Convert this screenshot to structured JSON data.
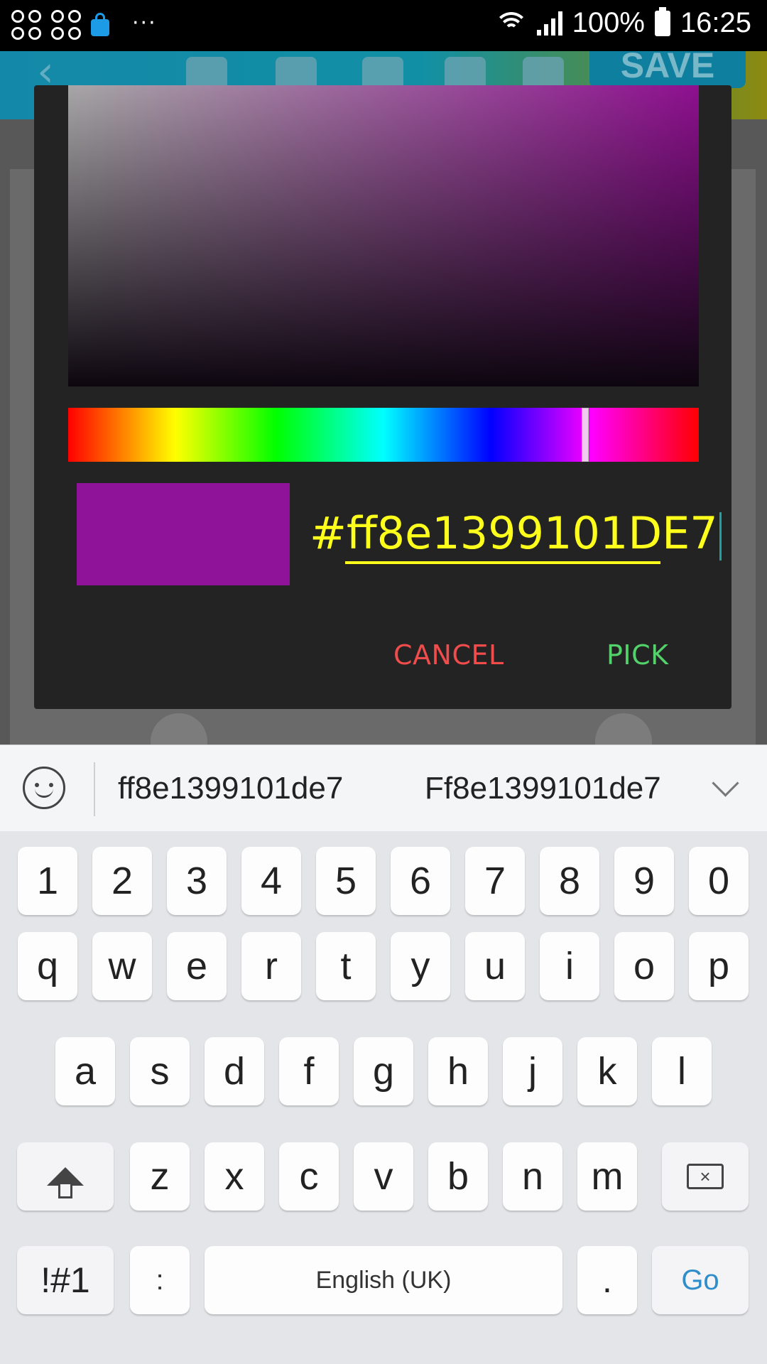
{
  "status_bar": {
    "battery": "100%",
    "time": "16:25",
    "icons": [
      "app-icon",
      "app-icon",
      "shopping-bag-icon",
      "more-dots-icon",
      "wifi-icon",
      "signal-icon",
      "battery-icon"
    ]
  },
  "toolbar": {
    "save_label": "SAVE",
    "icons": [
      "back-icon",
      "layers-icon",
      "copy-icon",
      "lock-icon",
      "undo-icon",
      "redo-icon"
    ]
  },
  "color_dialog": {
    "hex_value": "#ff8e1399101DE7",
    "cancel_label": "CANCEL",
    "pick_label": "PICK",
    "preview_color": "#8e1399",
    "hue_position": 0.82,
    "colors": {
      "accent_input": "#ffff1c",
      "cancel": "#f04c4c",
      "pick": "#53d16a"
    }
  },
  "keyboard": {
    "suggestions": [
      "ff8e1399101de7",
      "Ff8e1399101de7"
    ],
    "row_numbers": [
      "1",
      "2",
      "3",
      "4",
      "5",
      "6",
      "7",
      "8",
      "9",
      "0"
    ],
    "row_q": [
      "q",
      "w",
      "e",
      "r",
      "t",
      "y",
      "u",
      "i",
      "o",
      "p"
    ],
    "row_a": [
      "a",
      "s",
      "d",
      "f",
      "g",
      "h",
      "j",
      "k",
      "l"
    ],
    "row_z": [
      "z",
      "x",
      "c",
      "v",
      "b",
      "n",
      "m"
    ],
    "symbols_label": "!#1",
    "colon_label": ":",
    "space_label": "English (UK)",
    "period_label": ".",
    "go_label": "Go"
  }
}
